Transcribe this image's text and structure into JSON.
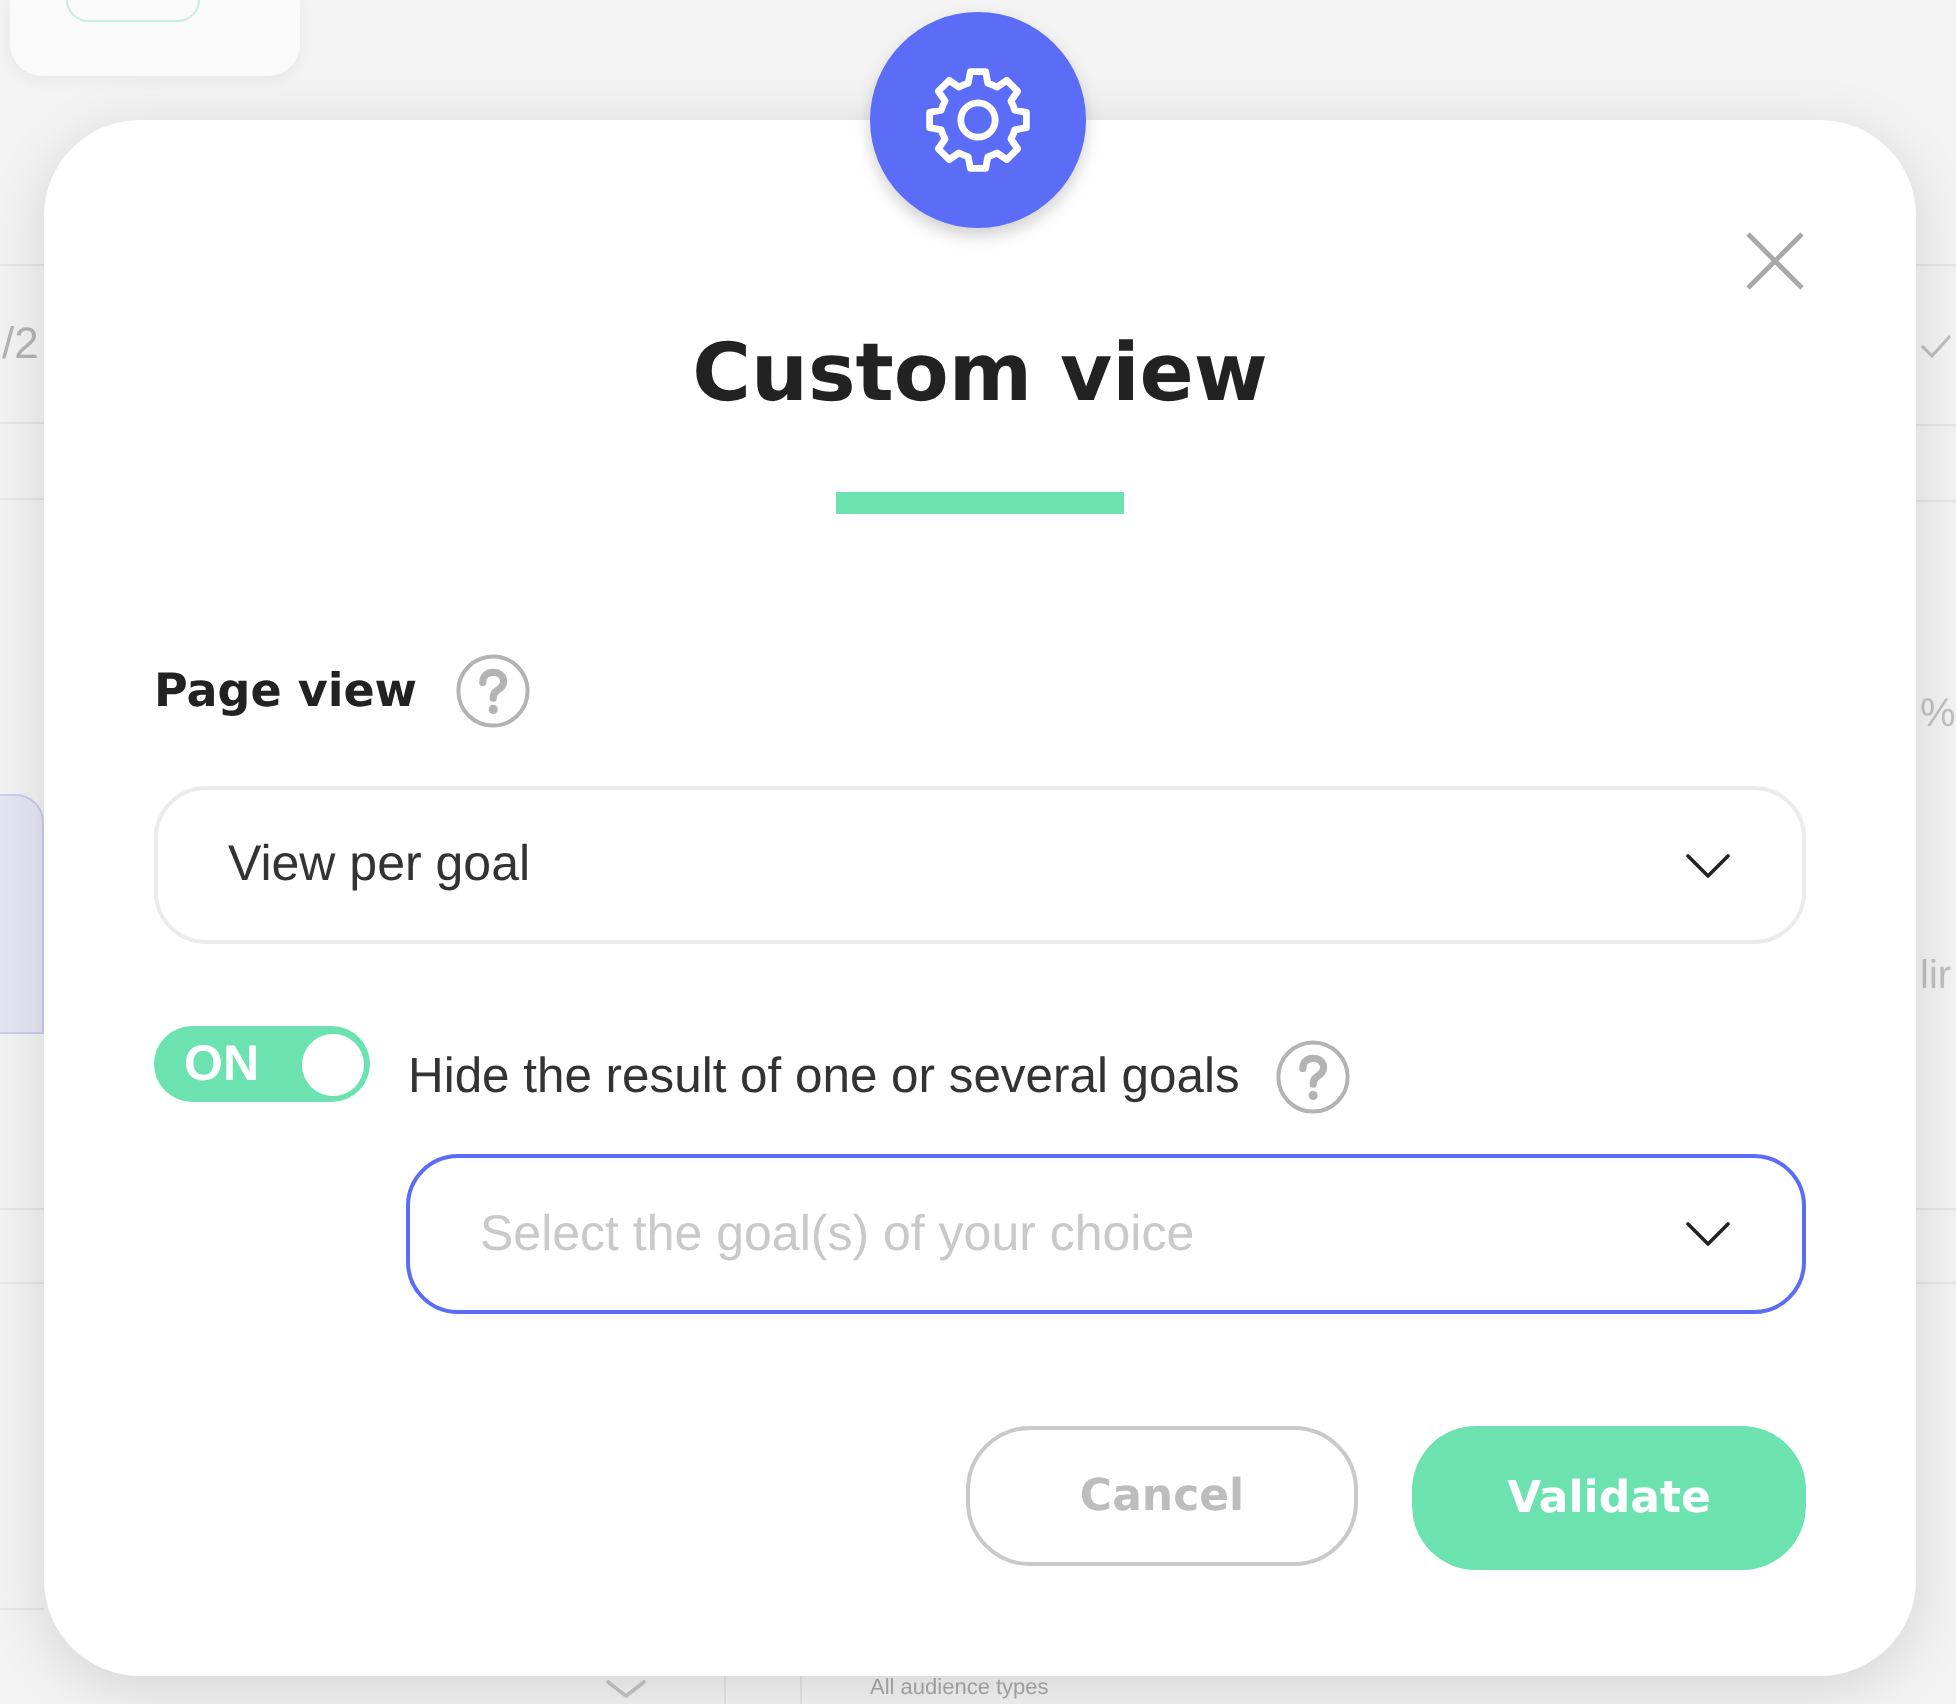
{
  "backdrop": {
    "left_text": "/2",
    "right_texts": [
      "%",
      "lir"
    ],
    "bottom_text": "All audience types"
  },
  "modal": {
    "title": "Custom view",
    "page_view": {
      "label": "Page view",
      "select": {
        "value": "View per goal"
      }
    },
    "hide_goals": {
      "toggle": {
        "on": true,
        "text": "ON"
      },
      "label": "Hide the result of one or several goals",
      "select": {
        "placeholder": "Select the goal(s) of your choice",
        "focused": true
      }
    },
    "buttons": [
      {
        "label": "Cancel",
        "kind": "secondary"
      },
      {
        "label": "Validate",
        "kind": "primary"
      }
    ]
  }
}
